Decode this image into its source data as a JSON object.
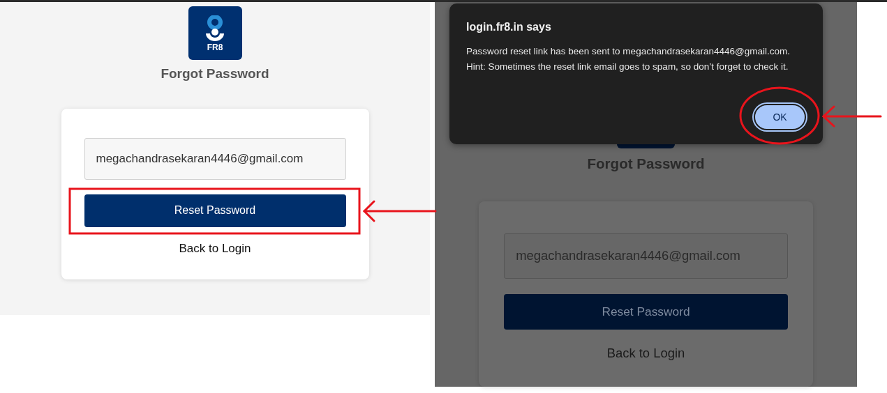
{
  "screens": [
    {
      "kind": "plain",
      "logo": {
        "text": "FR8"
      },
      "title": "Forgot Password",
      "email_field": {
        "value": "megachandrasekaran4446@gmail.com"
      },
      "submit_button": "Reset Password",
      "back_link": "Back to Login"
    },
    {
      "kind": "dimmed",
      "title": "Forgot Password",
      "email_field": {
        "value": "megachandrasekaran4446@gmail.com"
      },
      "submit_button": "Reset Password",
      "back_link": "Back to Login"
    }
  ],
  "dialog": {
    "title": "login.fr8.in says",
    "message": "Password reset link has been sent to megachandrasekaran4446@gmail.com. Hint: Sometimes the reset link email goes to spam, so don’t forget to check it.",
    "button": "OK"
  }
}
